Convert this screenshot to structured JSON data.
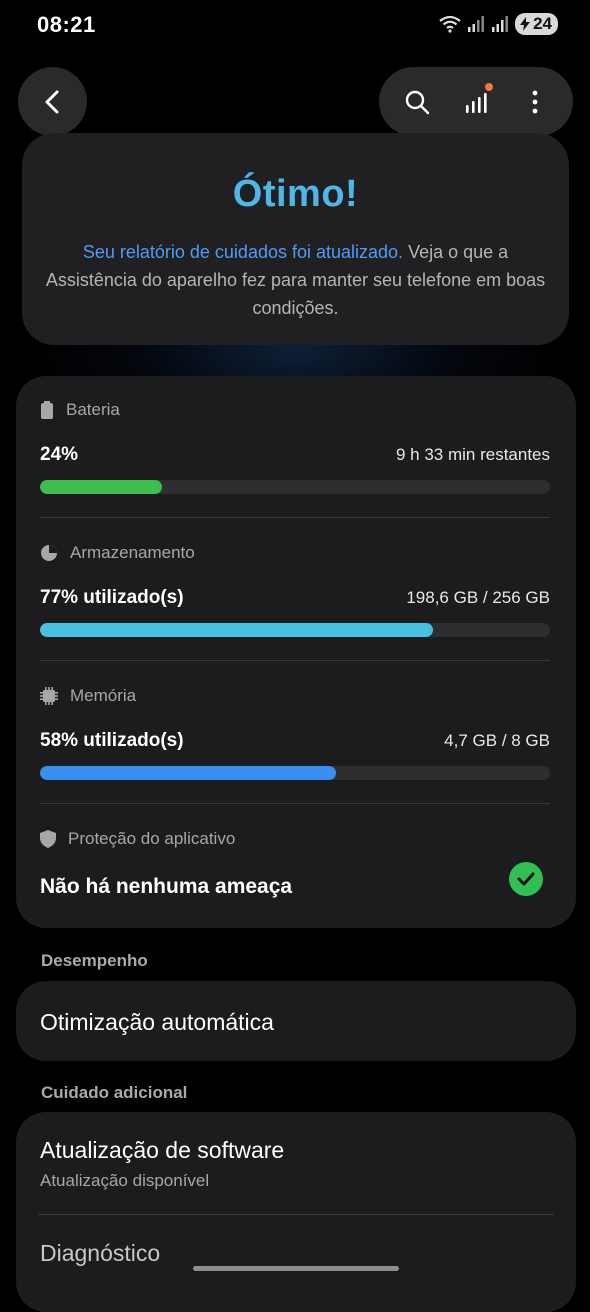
{
  "status_bar": {
    "time": "08:21",
    "battery": "24"
  },
  "hero": {
    "title": "Ótimo!",
    "link_text": "Seu relatório de cuidados foi atualizado.",
    "desc_rest": " Veja o que a Assistência do aparelho fez para manter seu telefone em boas condições."
  },
  "battery": {
    "label": "Bateria",
    "value": "24%",
    "remaining": "9 h 33 min restantes",
    "percent": 24,
    "color": "#3dbe4f"
  },
  "storage": {
    "label": "Armazenamento",
    "value": "77% utilizado(s)",
    "amount": "198,6 GB / 256 GB",
    "percent": 77,
    "color": "#48c0df"
  },
  "memory": {
    "label": "Memória",
    "value": "58% utilizado(s)",
    "amount": "4,7 GB / 8 GB",
    "percent": 58,
    "color": "#3a8ef0"
  },
  "protection": {
    "label": "Proteção do aplicativo",
    "status": "Não há nenhuma ameaça"
  },
  "performance": {
    "section_label": "Desempenho",
    "item": "Otimização automática"
  },
  "extra_care": {
    "section_label": "Cuidado adicional",
    "items": [
      {
        "title": "Atualização de software",
        "subtitle": "Atualização disponível"
      },
      {
        "title": "Diagnóstico"
      }
    ]
  },
  "icons": [
    "wifi-icon",
    "signal-icon",
    "battery-icon",
    "back-icon",
    "search-icon",
    "chart-icon",
    "more-icon",
    "battery-small-icon",
    "storage-icon",
    "memory-icon",
    "shield-icon",
    "check-icon"
  ]
}
